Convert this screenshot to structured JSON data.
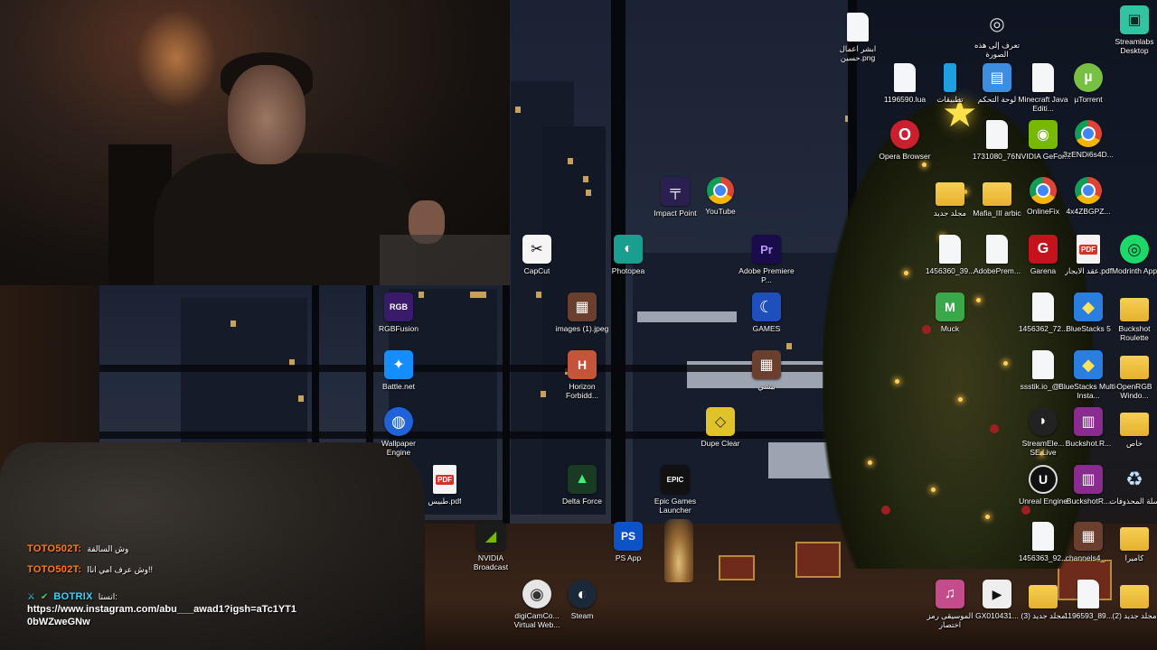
{
  "colors": {
    "chat_user_toto": "#ff7a1a",
    "chat_user_botrix": "#35d6ff",
    "chrome": "#4285f4"
  },
  "webcam": {
    "description_icon": "streamer-webcam"
  },
  "desktop_icons": [
    {
      "id": "wallpaper-file",
      "label": "ابشر اعمال حسين.png",
      "icon": "file-icon"
    },
    {
      "id": "learn-about-picture",
      "label": "تعرف إلى هذه الصورة",
      "icon": "camera-icon"
    },
    {
      "id": "streamlabs",
      "label": "Streamlabs Desktop",
      "icon": "streamlabs-icon"
    },
    {
      "id": "lua-file",
      "label": "1196590.lua",
      "icon": "file-icon"
    },
    {
      "id": "apps",
      "label": "تطبيقات",
      "icon": "phone-icon"
    },
    {
      "id": "control-panel",
      "label": "لوحة التحكم",
      "icon": "control-panel-icon"
    },
    {
      "id": "minecraft",
      "label": "Minecraft Java Editi...",
      "icon": "file-icon"
    },
    {
      "id": "utorrent",
      "label": "µTorrent",
      "icon": "utorrent-icon"
    },
    {
      "id": "opera",
      "label": "Opera Browser",
      "icon": "opera-icon"
    },
    {
      "id": "file-1731080",
      "label": "1731080_76...",
      "icon": "file-icon"
    },
    {
      "id": "nvidia-geforce",
      "label": "NVIDIA GeFor...",
      "icon": "nvidia-icon"
    },
    {
      "id": "chrome-3z",
      "label": "3zENDi6s4D...",
      "icon": "chrome-icon"
    },
    {
      "id": "impact-point",
      "label": "Impact Point",
      "icon": "gun-icon"
    },
    {
      "id": "youtube",
      "label": "YouTube",
      "icon": "chrome-icon"
    },
    {
      "id": "new-folder-1",
      "label": "مجلد جديد",
      "icon": "folder-icon"
    },
    {
      "id": "mafia",
      "label": "Mafia_III arbic",
      "icon": "folder-icon"
    },
    {
      "id": "onlinefix",
      "label": "OnlineFix",
      "icon": "chrome-icon"
    },
    {
      "id": "chrome-4x",
      "label": "4x4ZBGPZ...",
      "icon": "chrome-icon"
    },
    {
      "id": "capcut",
      "label": "CapCut",
      "icon": "capcut-icon"
    },
    {
      "id": "photopea",
      "label": "Photopea",
      "icon": "photopea-icon"
    },
    {
      "id": "premiere",
      "label": "Adobe Premiere P...",
      "icon": "premiere-icon"
    },
    {
      "id": "file-1456360-39",
      "label": "1456360_39...",
      "icon": "file-icon"
    },
    {
      "id": "adobe-prem-file",
      "label": "AdobePrem...",
      "icon": "file-icon"
    },
    {
      "id": "garena",
      "label": "Garena",
      "icon": "garena-icon"
    },
    {
      "id": "contract-pdf",
      "label": "عقد الايجار.pdf",
      "icon": "pdf-icon"
    },
    {
      "id": "modrinth",
      "label": "Modrinth App",
      "icon": "modrinth-icon"
    },
    {
      "id": "rgbfusion",
      "label": "RGBFusion",
      "icon": "rgb-icon"
    },
    {
      "id": "images-jpeg",
      "label": "images (1).jpeg",
      "icon": "image-icon"
    },
    {
      "id": "games",
      "label": "GAMES",
      "icon": "moon-icon"
    },
    {
      "id": "muck",
      "label": "Muck",
      "icon": "muck-icon"
    },
    {
      "id": "file-1456362-72",
      "label": "1456362_72...",
      "icon": "file-icon"
    },
    {
      "id": "bluestacks5",
      "label": "BlueStacks 5",
      "icon": "bluestacks-icon"
    },
    {
      "id": "buckshot-roulette",
      "label": "Buckshot Roulette",
      "icon": "folder-icon"
    },
    {
      "id": "battlenet",
      "label": "Battle.net",
      "icon": "battlenet-icon"
    },
    {
      "id": "horizon",
      "label": "Horizon Forbidd...",
      "icon": "horizon-icon"
    },
    {
      "id": "image-pc",
      "label": "ببشي",
      "icon": "image-icon"
    },
    {
      "id": "ssstik",
      "label": "ssstik.io_@...",
      "icon": "file-icon"
    },
    {
      "id": "bluestacks-multi",
      "label": "BlueStacks Multi-Insta...",
      "icon": "bluestacks-icon"
    },
    {
      "id": "openrgb",
      "label": "OpenRGB Windo...",
      "icon": "folder-icon"
    },
    {
      "id": "wallpaper-engine",
      "label": "Wallpaper Engine",
      "icon": "wallpaper-engine-icon"
    },
    {
      "id": "dupe-clear",
      "label": "Dupe Clear",
      "icon": "dupe-icon"
    },
    {
      "id": "streamelements",
      "label": "StreamEle... SE.Live",
      "icon": "streamelements-icon"
    },
    {
      "id": "buckshot-rar-1",
      "label": "Buckshot.R...",
      "icon": "winrar-icon"
    },
    {
      "id": "folder-khas",
      "label": "خاص",
      "icon": "folder-icon"
    },
    {
      "id": "pdf-tabees",
      "label": "طبيس.pdf",
      "icon": "pdf-icon"
    },
    {
      "id": "delta-force",
      "label": "Delta Force",
      "icon": "delta-icon"
    },
    {
      "id": "epic",
      "label": "Epic Games Launcher",
      "icon": "epic-icon"
    },
    {
      "id": "unreal",
      "label": "Unreal Engine",
      "icon": "unreal-icon"
    },
    {
      "id": "buckshot-rar-2",
      "label": "BuckshotR...",
      "icon": "winrar-icon"
    },
    {
      "id": "recycle-bin",
      "label": "سلة المحذوفات",
      "icon": "recycle-bin-icon"
    },
    {
      "id": "nvidia-broadcast",
      "label": "NVIDIA Broadcast",
      "icon": "nvidia-broadcast-icon"
    },
    {
      "id": "ps-app",
      "label": "PS App",
      "icon": "playstation-icon"
    },
    {
      "id": "file-1456363-92",
      "label": "1456363_92...",
      "icon": "file-icon"
    },
    {
      "id": "channels",
      "label": "channels4_...",
      "icon": "image-icon"
    },
    {
      "id": "camera-folder",
      "label": "كاميرا",
      "icon": "folder-icon"
    },
    {
      "id": "digicam",
      "label": "digiCamCo... Virtual Web...",
      "icon": "digicam-icon"
    },
    {
      "id": "steam",
      "label": "Steam",
      "icon": "steam-icon"
    },
    {
      "id": "music-folder",
      "label": "الموسيقى رمز اختصار",
      "icon": "music-icon"
    },
    {
      "id": "gx-file",
      "label": "GX010431...",
      "icon": "video-icon"
    },
    {
      "id": "new-folder-3",
      "label": "مجلد جديد (3)",
      "icon": "folder-icon"
    },
    {
      "id": "file-1196593",
      "label": "1196593_89...",
      "icon": "file-icon"
    },
    {
      "id": "new-folder-2",
      "label": "مجلد جديد (2)",
      "icon": "folder-icon"
    }
  ],
  "chat": {
    "lines": [
      {
        "user": "TOTO502T:",
        "message": "وش السالفة"
      },
      {
        "user": "TOTO502T:",
        "message": "وش عرف امي اناا!!"
      },
      {
        "user": "BOTRIX",
        "message": "انستا:"
      }
    ],
    "link": "https://www.instagram.com/abu___awad1?igsh=aTc1YT10bWZweGNw"
  }
}
